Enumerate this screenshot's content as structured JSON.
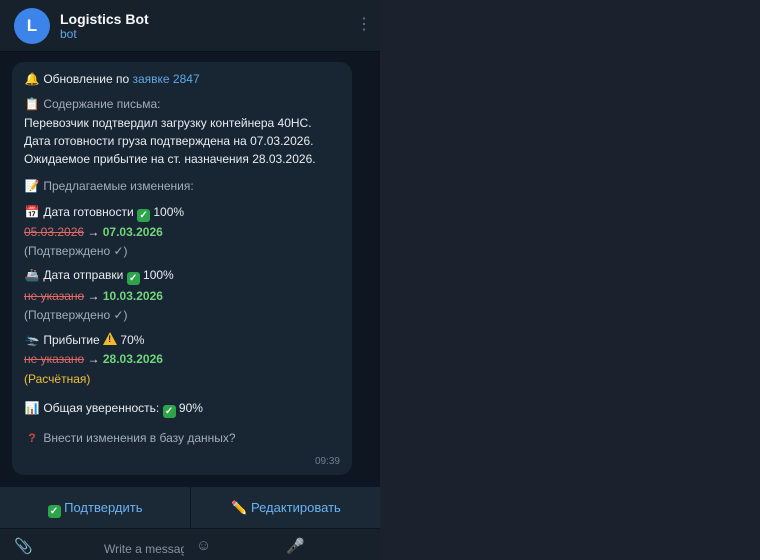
{
  "header": {
    "avatar_letter": "L",
    "title": "Logistics Bot",
    "status": "bot"
  },
  "message": {
    "l1_prefix": "Обновление по",
    "l1_link": "заявке 2847",
    "content_label": "Содержание письма:",
    "body1": "Перевозчик подтвердил загрузку контейнера 40HC.",
    "body2": "Дата готовности груза подтверждена на 07.03.2026.",
    "body3": "Ожидаемое прибытие на ст. назначения 28.03.2026.",
    "changes_label": "Предлагаемые изменения:",
    "ready": {
      "label": "Дата готовности",
      "confidence": "100%",
      "old": "05.03.2026",
      "arrow": "→",
      "new": "07.03.2026",
      "note": "(Подтверждено ✓)"
    },
    "ship": {
      "label": "Дата отправки",
      "confidence": "100%",
      "old": "не указано",
      "arrow": "→",
      "new": "10.03.2026",
      "note": "(Подтверждено ✓)"
    },
    "arrival": {
      "label": "Прибытие",
      "confidence": "70%",
      "old": "не указано",
      "arrow": "→",
      "new": "28.03.2026",
      "note": "(Расчётная)"
    },
    "overall_label": "Общая уверенность:",
    "overall_value": "90%",
    "question": "Внести изменения в базу данных?",
    "time": "09:39"
  },
  "keyboard": {
    "confirm": "Подтвердить",
    "edit": "Редактировать"
  },
  "composer": {
    "placeholder": "Write a message..."
  },
  "icons": {
    "bell": "bell-icon",
    "clipboard": "clipboard-icon",
    "memo": "memo-icon",
    "calendar": "calendar-icon",
    "ship": "ship-icon",
    "arrival": "arrival-icon",
    "chart": "bar-chart-icon",
    "question": "question-mark-icon",
    "check": "check-mark-icon",
    "warning": "warning-icon",
    "pencil": "pencil-icon",
    "paperclip": "paperclip-icon",
    "emoji": "emoji-icon",
    "mic": "microphone-icon",
    "menu": "more-vertical-icon"
  },
  "colors": {
    "panel_bg": "#0e1621",
    "bubble_bg": "#182533",
    "link": "#5fa8e6",
    "old_value": "#e06a66",
    "new_value": "#6fd67a",
    "estimate": "#f0c23a"
  }
}
